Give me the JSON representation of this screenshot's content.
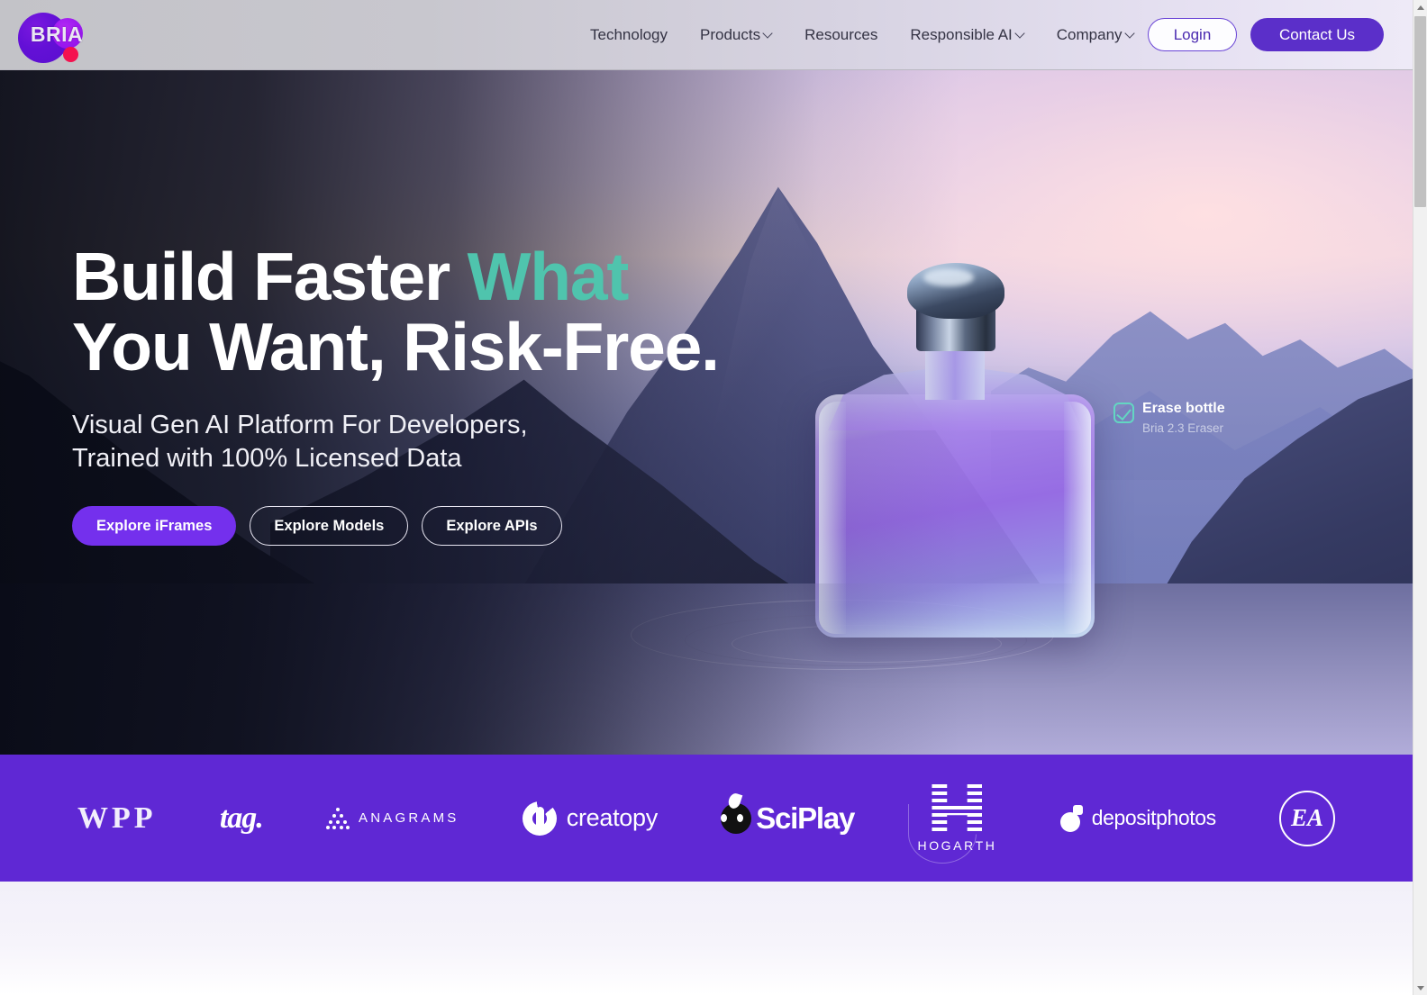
{
  "header": {
    "logo": {
      "text": "BRIA",
      "name": "bria-logo"
    },
    "nav": [
      {
        "label": "Technology",
        "has_caret": false
      },
      {
        "label": "Products",
        "has_caret": true
      },
      {
        "label": "Resources",
        "has_caret": false
      },
      {
        "label": "Responsible AI",
        "has_caret": true
      },
      {
        "label": "Company",
        "has_caret": true
      }
    ],
    "login_label": "Login",
    "contact_label": "Contact Us"
  },
  "hero": {
    "headline_line1_plain": "Build Faster ",
    "headline_line1_accent": "What",
    "headline_line2": "You Want, Risk-Free.",
    "subheadline_line1": "Visual Gen AI Platform For Developers,",
    "subheadline_line2": "Trained with 100% Licensed Data",
    "buttons": [
      {
        "label": "Explore iFrames",
        "style": "primary"
      },
      {
        "label": "Explore Models",
        "style": "ghost"
      },
      {
        "label": "Explore APIs",
        "style": "ghost"
      }
    ],
    "annotation": {
      "title": "Erase bottle",
      "subtitle": "Bria 2.3 Eraser",
      "icon": "check-square-icon"
    }
  },
  "logo_band": {
    "logos": [
      {
        "name": "wpp",
        "label": "WPP"
      },
      {
        "name": "tag",
        "label": "tag."
      },
      {
        "name": "anagrams",
        "label": "ANAGRAMS"
      },
      {
        "name": "creatopy",
        "label": "creatopy"
      },
      {
        "name": "sciplay",
        "label": "SciPlay"
      },
      {
        "name": "hogarth",
        "label": "HOGARTH"
      },
      {
        "name": "depositphotos",
        "label": "depositphotos"
      },
      {
        "name": "ea",
        "label": "EA"
      }
    ]
  },
  "colors": {
    "brand_purple": "#5f28d4",
    "cta_purple": "#7430ed",
    "contact_purple": "#5b2fc9",
    "accent_teal": "#4fc4ad",
    "annotation_teal": "#63d6c2",
    "logo_dot_pink": "#f4124f",
    "band_background": "#5f28d4"
  }
}
